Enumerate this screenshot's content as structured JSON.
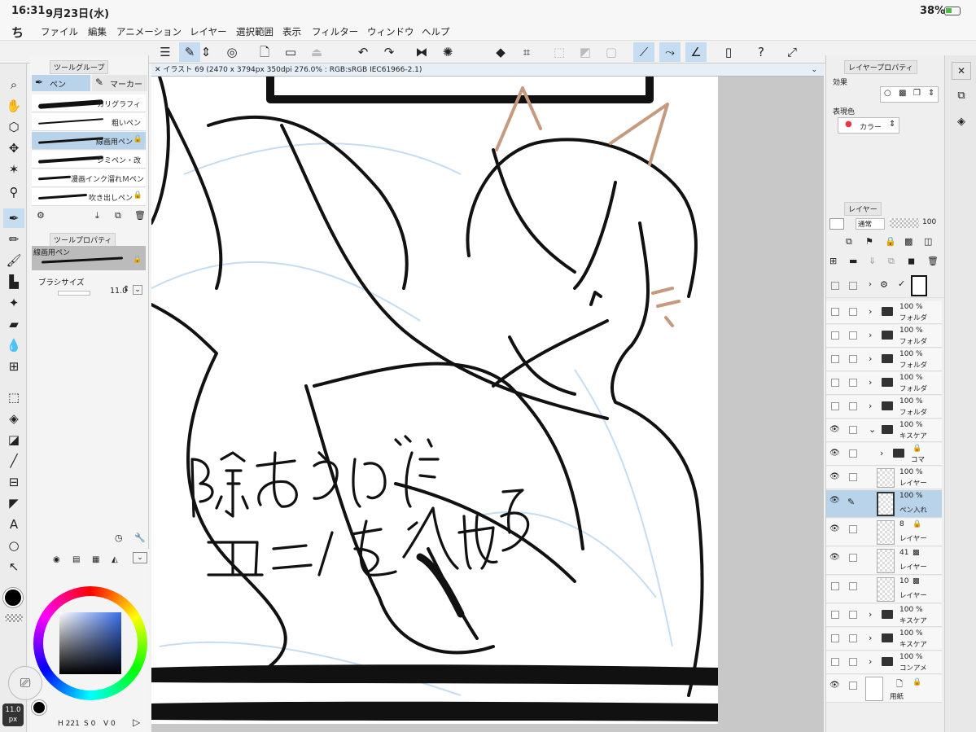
{
  "status": {
    "time": "16:31",
    "date": "9月23日(水)",
    "battery": "38%"
  },
  "menu": [
    "ファイル",
    "編集",
    "アニメーション",
    "レイヤー",
    "選択範囲",
    "表示",
    "フィルター",
    "ウィンドウ",
    "ヘルプ"
  ],
  "canvas": {
    "tab_title": "イラスト 69 (2470 x 3794px 350dpi 276.0% : RGB:sRGB IEC61966-2.1)"
  },
  "tool_group": {
    "title": "ツールグループ",
    "tabs": [
      "ペン",
      "マーカー"
    ],
    "brushes": [
      "カリグラフィ",
      "粗いペン",
      "線画用ペン",
      "シミペン・改",
      "漫画インク溜れＭペン",
      "吹き出しペン"
    ],
    "selected_index": 2
  },
  "tool_property": {
    "title": "ツールプロパティ",
    "brush_name": "線画用ペン",
    "size_label": "ブラシサイズ",
    "size_value": "11.0"
  },
  "color": {
    "main": "#000000",
    "hsv_readout": {
      "h": "221",
      "s": "0",
      "v": "0"
    },
    "size_badge": "11.0",
    "size_unit": "px"
  },
  "layer_property": {
    "title": "レイヤープロパティ",
    "effect_label": "効果",
    "express_label": "表現色",
    "express_value": "カラー"
  },
  "layers_panel": {
    "title": "レイヤー",
    "blend_mode": "通常",
    "opacity": "100"
  },
  "layers": [
    {
      "pct": "100 %",
      "name": "フォルダ",
      "type": "folder",
      "visible": false
    },
    {
      "pct": "100 %",
      "name": "フォルダ",
      "type": "folder",
      "visible": false
    },
    {
      "pct": "100 %",
      "name": "フォルダ",
      "type": "folder",
      "visible": false
    },
    {
      "pct": "100 %",
      "name": "フォルダ",
      "type": "folder",
      "visible": false
    },
    {
      "pct": "100 %",
      "name": "フォルダ",
      "type": "folder",
      "visible": false
    },
    {
      "pct": "100 %",
      "name": "キスケア",
      "type": "folder",
      "visible": true
    },
    {
      "pct": "",
      "name": "コマ",
      "type": "folder",
      "visible": true
    },
    {
      "pct": "100 %",
      "name": "レイヤー",
      "type": "raster",
      "visible": true
    },
    {
      "pct": "100 %",
      "name": "ペン入れ",
      "type": "raster",
      "visible": true,
      "selected": true
    },
    {
      "pct": "8",
      "name": "レイヤー",
      "type": "raster",
      "visible": true
    },
    {
      "pct": "41",
      "name": "レイヤー",
      "type": "raster",
      "visible": true
    },
    {
      "pct": "10",
      "name": "レイヤー",
      "type": "raster",
      "visible": false
    },
    {
      "pct": "100 %",
      "name": "キスケア",
      "type": "folder",
      "visible": false
    },
    {
      "pct": "100 %",
      "name": "キスケア",
      "type": "folder",
      "visible": false
    },
    {
      "pct": "100 %",
      "name": "コンアメ",
      "type": "folder",
      "visible": false
    },
    {
      "pct": "",
      "name": "用紙",
      "type": "paper",
      "visible": true
    }
  ],
  "drawing": {
    "handwritten_line1": "隙あらば",
    "handwritten_line2": "ユニ/を入れる",
    "ear_color": "#c59a7e"
  }
}
